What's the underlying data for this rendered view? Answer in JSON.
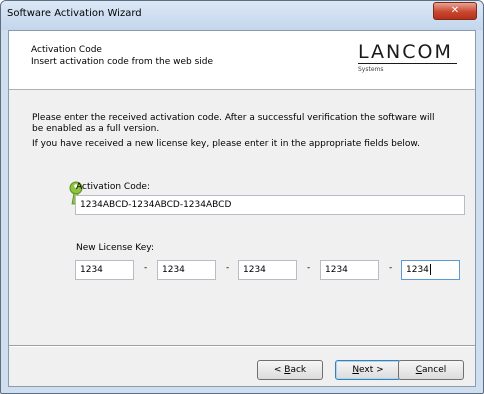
{
  "window": {
    "title": "Software Activation Wizard",
    "close_glyph": "✕"
  },
  "header": {
    "title": "Activation Code",
    "subtitle": "Insert activation code from the web side",
    "logo": {
      "brand": "LANCOM",
      "tagline": "Systems"
    }
  },
  "body": {
    "description_line1": "Please enter the received activation code. After a successful verification the software will",
    "description_line2": "be enabled as a full version.",
    "description_line3": "If you have received a new license key, please enter it in the appropriate fields below.",
    "key_icon": "key-icon",
    "activation_code_label": "Activation Code:",
    "activation_code_value": "1234ABCD-1234ABCD-1234ABCD",
    "license_key_label": "New License Key:",
    "license_key_fields": [
      "1234",
      "1234",
      "1234",
      "1234",
      "1234"
    ],
    "separator": "-"
  },
  "buttons": {
    "back": {
      "prefix": "< ",
      "mnemonic": "B",
      "rest": "ack"
    },
    "next": {
      "mnemonic": "N",
      "rest": "ext >"
    },
    "cancel": {
      "mnemonic": "C",
      "rest": "ancel"
    }
  },
  "colors": {
    "key": "#8cc63f",
    "logo": "#1a1a1a",
    "close_button": "#c9472e"
  }
}
